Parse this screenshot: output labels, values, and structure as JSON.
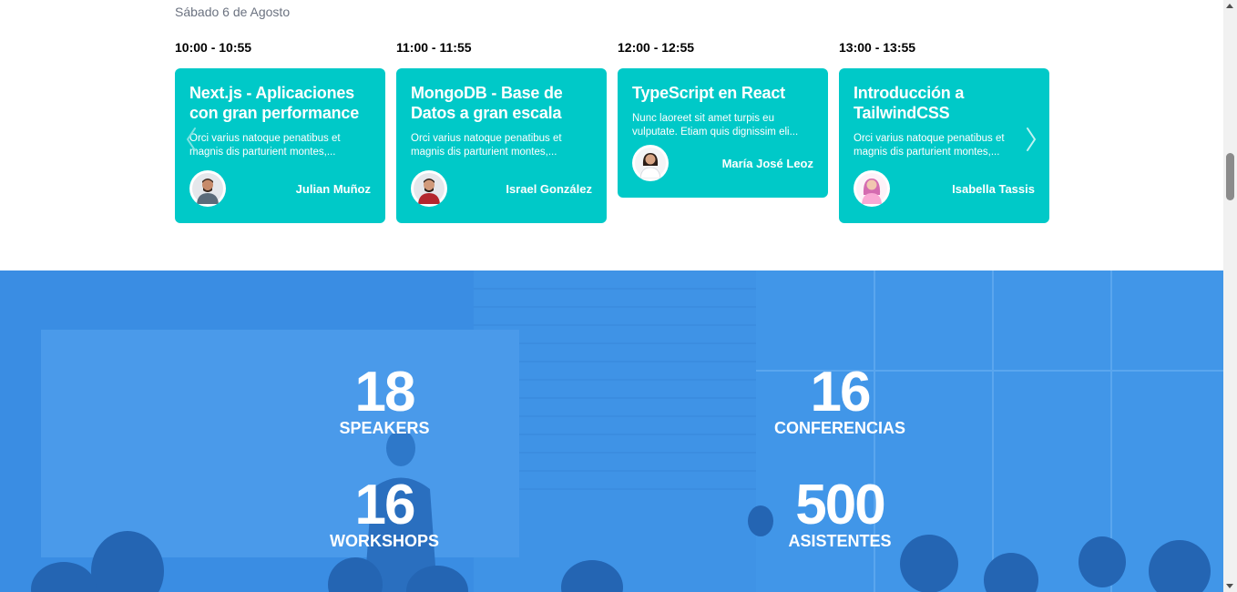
{
  "schedule": {
    "day": "Sábado 6 de Agosto",
    "slots": [
      {
        "time": "10:00 - 10:55",
        "title": "Next.js - Aplicaciones con gran performance",
        "description": "Orci varius natoque penatibus et magnis dis parturient montes,...",
        "speaker": "Julian Muñoz"
      },
      {
        "time": "11:00 - 11:55",
        "title": "MongoDB - Base de Datos a gran escala",
        "description": "Orci varius natoque penatibus et magnis dis parturient montes,...",
        "speaker": "Israel González"
      },
      {
        "time": "12:00 - 12:55",
        "title": "TypeScript en React",
        "description": "Nunc laoreet sit amet turpis eu vulputate. Etiam quis dignissim eli...",
        "speaker": "María José Leoz"
      },
      {
        "time": "13:00 - 13:55",
        "title": "Introducción a TailwindCSS",
        "description": "Orci varius natoque penatibus et magnis dis parturient montes,...",
        "speaker": "Isabella Tassis"
      }
    ],
    "prev_icon": "chevron-left-icon",
    "next_icon": "chevron-right-icon"
  },
  "stats": [
    {
      "number": "18",
      "label": "SPEAKERS"
    },
    {
      "number": "16",
      "label": "CONFERENCIAS"
    },
    {
      "number": "16",
      "label": "WORKSHOPS"
    },
    {
      "number": "500",
      "label": "ASISTENTES"
    }
  ],
  "colors": {
    "card": "#00c9c8",
    "stats_overlay": "#3a8de3"
  }
}
